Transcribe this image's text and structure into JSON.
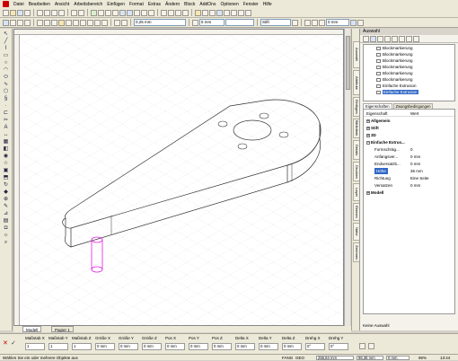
{
  "menu": [
    "Datei",
    "Bearbeiten",
    "Ansicht",
    "Arbeitsbereich",
    "Einfügen",
    "Format",
    "Extras",
    "Ändern",
    "Block",
    "AddOns",
    "Optionen",
    "Fenster",
    "Hilfe"
  ],
  "toolbar": {
    "angle_value": "0,25 mm",
    "width_value": "5 mm",
    "layer_value": "Stift",
    "z_value": "0 mm"
  },
  "panel": {
    "title": "Auswahl",
    "tree_items": [
      "Blockmarkierung",
      "Blockmarkierung",
      "Blockmarkierung",
      "Blockmarkierung",
      "Blockmarkierung",
      "Blockmarkierung",
      "Einfache Extrusion",
      "Einfache Extrusion"
    ],
    "tabs": [
      "Eigenschaften",
      "Zwangsbedingungen"
    ],
    "col_property": "Eigenschaft",
    "col_value": "Wert",
    "groups": [
      "Allgemein",
      "Stift",
      "3D",
      "Einfache Extrus..."
    ],
    "props": [
      {
        "k": "Formschräg...",
        "v": "0"
      },
      {
        "k": "Anfangsver...",
        "v": "0 mm"
      },
      {
        "k": "Endversatzb...",
        "v": "0 mm"
      },
      {
        "k": "Höhe",
        "v": "36 mm"
      },
      {
        "k": "Richtung",
        "v": "Eine Seite"
      },
      {
        "k": "Versatzen",
        "v": "0 mm"
      }
    ],
    "footer_group": "Modell",
    "footer_text": "Keine Auswahl"
  },
  "side_tabs": [
    "Auswahl",
    "Attribute",
    "Einfügen",
    "Bibliothek",
    "Details",
    "Drucken",
    "Layer",
    "Ebenen",
    "Nähe",
    "Zeichnen"
  ],
  "model_tabs": [
    "Modell",
    "Papier 1"
  ],
  "coords": [
    {
      "label": "Maßstab X",
      "value": "1"
    },
    {
      "label": "Maßstab Y",
      "value": "1"
    },
    {
      "label": "Maßstab Z",
      "value": "1"
    },
    {
      "label": "Größe X",
      "value": "0 mm"
    },
    {
      "label": "Größe Y",
      "value": "0 mm"
    },
    {
      "label": "Größe Z",
      "value": "0 mm"
    },
    {
      "label": "Pos X",
      "value": "0 mm"
    },
    {
      "label": "Pos Y",
      "value": "0 mm"
    },
    {
      "label": "Pos Z",
      "value": "0 mm"
    },
    {
      "label": "Delta X",
      "value": "0 mm"
    },
    {
      "label": "Delta Y",
      "value": "0 mm"
    },
    {
      "label": "Delta Z",
      "value": "0 mm"
    },
    {
      "label": "Drehg X",
      "value": "0°"
    },
    {
      "label": "Drehg Y",
      "value": "0°"
    }
  ],
  "status": {
    "message": "Wählen Sie ein oder mehrere Objekte aus",
    "fang": "FANG",
    "geo": "GEO",
    "x": "256,84 mm",
    "y": "96,35 mm",
    "z": "0 mm",
    "zoom": "96%",
    "time": "13:44"
  }
}
